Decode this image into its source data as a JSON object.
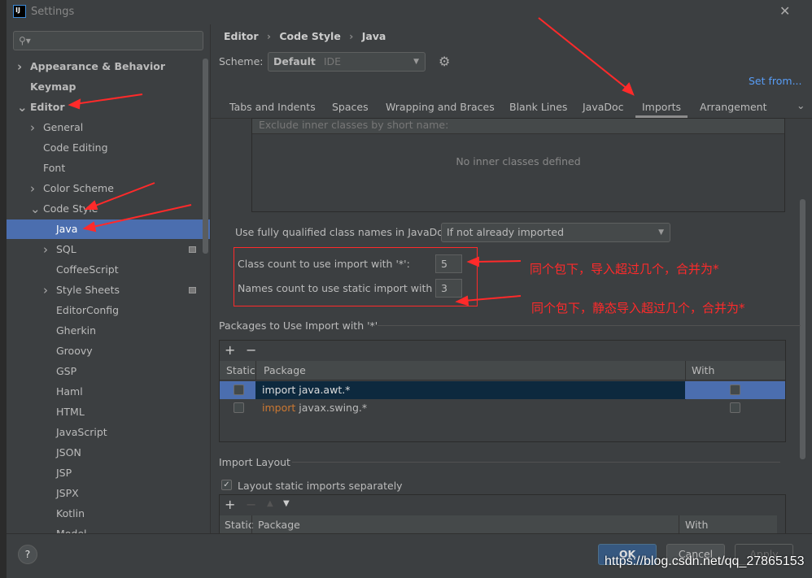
{
  "window": {
    "title": "Settings",
    "search_placeholder": ""
  },
  "sidebar": {
    "items": [
      {
        "label": "Appearance & Behavior"
      },
      {
        "label": "Keymap"
      },
      {
        "label": "Editor"
      },
      {
        "label": "General"
      },
      {
        "label": "Code Editing"
      },
      {
        "label": "Font"
      },
      {
        "label": "Color Scheme"
      },
      {
        "label": "Code Style"
      },
      {
        "label": "Java"
      },
      {
        "label": "SQL"
      },
      {
        "label": "CoffeeScript"
      },
      {
        "label": "Style Sheets"
      },
      {
        "label": "EditorConfig"
      },
      {
        "label": "Gherkin"
      },
      {
        "label": "Groovy"
      },
      {
        "label": "GSP"
      },
      {
        "label": "Haml"
      },
      {
        "label": "HTML"
      },
      {
        "label": "JavaScript"
      },
      {
        "label": "JSON"
      },
      {
        "label": "JSP"
      },
      {
        "label": "JSPX"
      },
      {
        "label": "Kotlin"
      },
      {
        "label": "Model..."
      }
    ]
  },
  "breadcrumb": [
    "Editor",
    "Code Style",
    "Java"
  ],
  "scheme": {
    "label": "Scheme:",
    "value": "Default",
    "sub": "IDE",
    "set_from": "Set from..."
  },
  "tabs": [
    "Tabs and Indents",
    "Spaces",
    "Wrapping and Braces",
    "Blank Lines",
    "JavaDoc",
    "Imports",
    "Arrangement"
  ],
  "exclude": {
    "header": "Exclude inner classes by short name:",
    "empty": "No inner classes defined"
  },
  "javadoc": {
    "label": "Use fully qualified class names in JavaDoc:",
    "value": "If not already imported"
  },
  "class_count": {
    "label": "Class count to use import with '*':",
    "value": "5"
  },
  "names_count": {
    "label": "Names count to use static import with '*':",
    "value": "3"
  },
  "annotations": [
    "同个包下，导入超过几个，合并为*",
    "同个包下，静态导入超过几个，合并为*"
  ],
  "packages": {
    "title": "Packages to Use Import with '*'",
    "add": "+",
    "remove": "−",
    "columns": [
      "Static",
      "Package",
      "With Subpackages"
    ],
    "rows": [
      {
        "kw": "import",
        "pkg": "java.awt.*"
      },
      {
        "kw": "import",
        "pkg": "javax.swing.*"
      }
    ]
  },
  "layout": {
    "title": "Import Layout",
    "checkbox": "Layout static imports separately",
    "columns": [
      "Static",
      "Package",
      "With Subpackages"
    ]
  },
  "footer": {
    "help": "?",
    "ok": "OK",
    "cancel": "Cancel",
    "apply": "Apply"
  },
  "watermark": "https://blog.csdn.net/qq_27865153",
  "colors": {
    "selection": "#4b6eaf",
    "annotation": "#ff2a2a",
    "link": "#589df6",
    "keyword": "#cc7832"
  }
}
